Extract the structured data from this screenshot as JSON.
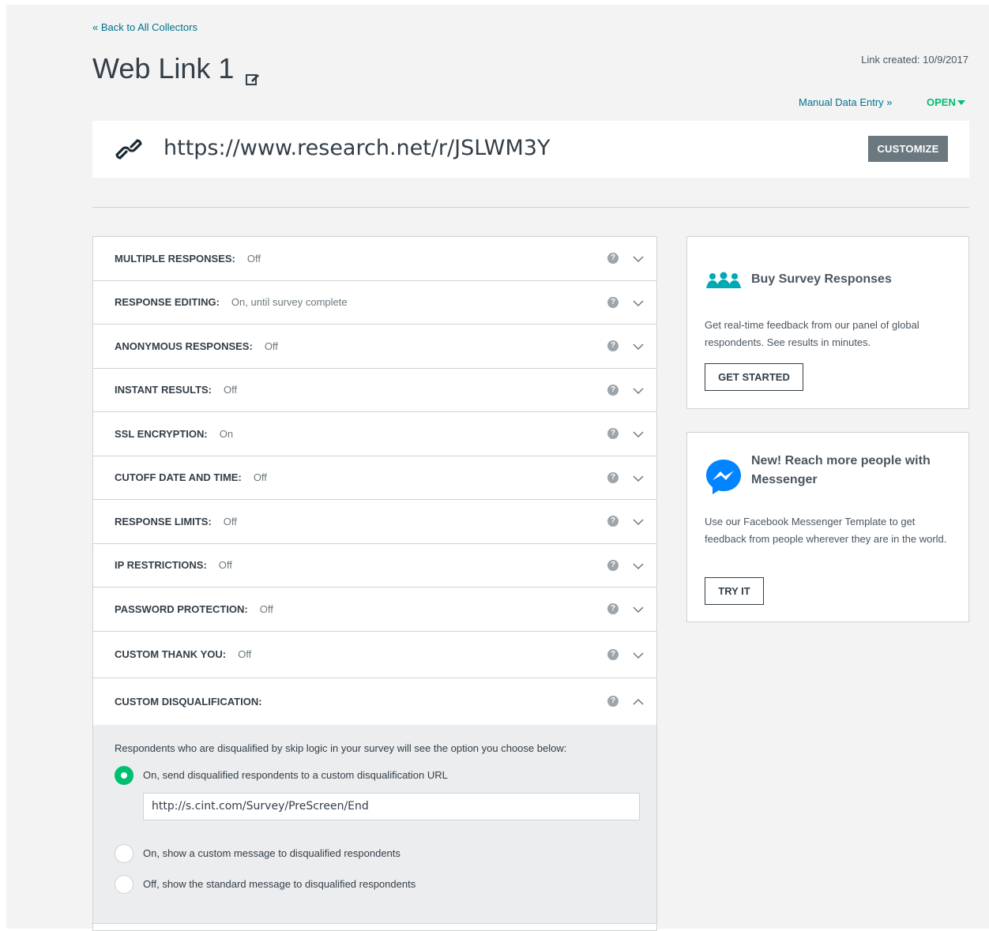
{
  "header": {
    "back_link": "« Back to All Collectors",
    "title": "Web Link 1",
    "link_created": "Link created: 10/9/2017",
    "manual_entry": "Manual Data Entry »",
    "status": "OPEN"
  },
  "link": {
    "url": "https://www.research.net/r/JSLWM3Y",
    "customize_label": "CUSTOMIZE"
  },
  "settings": [
    {
      "label": "MULTIPLE RESPONSES:",
      "value": "Off"
    },
    {
      "label": "RESPONSE EDITING:",
      "value": "On, until survey complete"
    },
    {
      "label": "ANONYMOUS RESPONSES:",
      "value": "Off"
    },
    {
      "label": "INSTANT RESULTS:",
      "value": "Off"
    },
    {
      "label": "SSL ENCRYPTION:",
      "value": "On"
    },
    {
      "label": "CUTOFF DATE AND TIME:",
      "value": "Off"
    },
    {
      "label": "RESPONSE LIMITS:",
      "value": "Off"
    },
    {
      "label": "IP RESTRICTIONS:",
      "value": "Off"
    },
    {
      "label": "PASSWORD PROTECTION:",
      "value": "Off"
    },
    {
      "label": "CUSTOM THANK YOU:",
      "value": "Off"
    },
    {
      "label": "CUSTOM DISQUALIFICATION:",
      "value": ""
    }
  ],
  "help_glyph": "?",
  "disqualification": {
    "intro": "Respondents who are disqualified by skip logic in your survey will see the option you choose below:",
    "options": [
      {
        "label": "On, send disqualified respondents to a custom disqualification URL",
        "checked": true
      },
      {
        "label": "On, show a custom message to disqualified respondents",
        "checked": false
      },
      {
        "label": "Off, show the standard message to disqualified respondents",
        "checked": false
      }
    ],
    "url_value": "http://s.cint.com/Survey/PreScreen/End"
  },
  "cards": {
    "buy": {
      "title": "Buy Survey Responses",
      "text": "Get real-time feedback from our panel of global respondents. See results in minutes.",
      "button": "GET STARTED",
      "icon": "people-group-icon"
    },
    "messenger": {
      "title": "New! Reach more people with Messenger",
      "text": "Use our Facebook Messenger Template to get feedback from people wherever they are in the world.",
      "button": "TRY IT",
      "icon": "messenger-icon"
    }
  },
  "colors": {
    "accent_green": "#00bf6f",
    "link_blue": "#00738c",
    "teal_icon": "#00bf6f",
    "messenger_blue": "#0084ff",
    "button_gray": "#6b787f"
  }
}
